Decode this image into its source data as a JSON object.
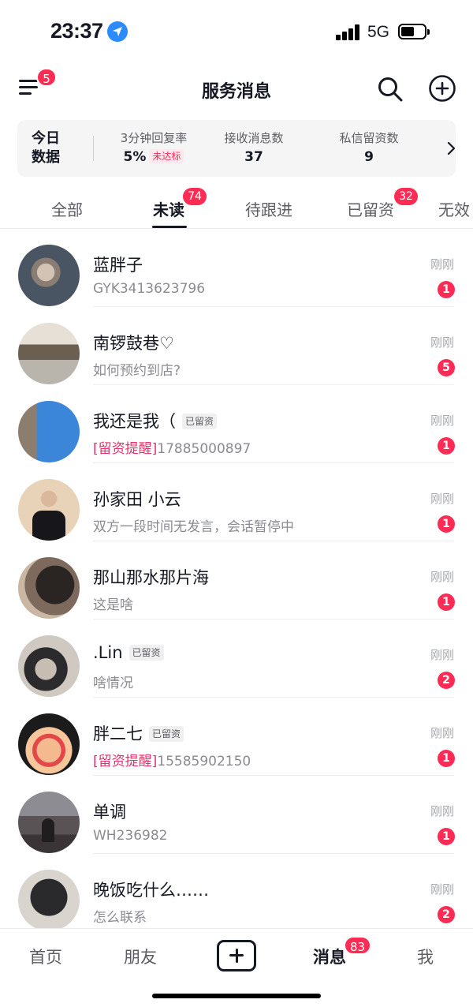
{
  "status_bar": {
    "time": "23:37",
    "network": "5G",
    "icons": [
      "location-icon",
      "signal-icon",
      "battery-icon"
    ]
  },
  "header": {
    "title": "服务消息",
    "menu_badge": "5",
    "icons": [
      "menu-icon",
      "search-icon",
      "add-circle-icon"
    ]
  },
  "stats": {
    "label_line1": "今日",
    "label_line2": "数据",
    "items": [
      {
        "label": "3分钟回复率",
        "value": "5%",
        "tag": "未达标"
      },
      {
        "label": "接收消息数",
        "value": "37"
      },
      {
        "label": "私信留资数",
        "value": "9"
      }
    ]
  },
  "tabs": [
    {
      "label": "全部"
    },
    {
      "label": "未读",
      "badge": "74",
      "active": true
    },
    {
      "label": "待跟进"
    },
    {
      "label": "已留资",
      "badge": "32"
    },
    {
      "label": "无效"
    }
  ],
  "messages": [
    {
      "name": "蓝胖子",
      "preview": "GYK3413623796",
      "time": "刚刚",
      "unread": "1"
    },
    {
      "name": "南锣鼓巷♡",
      "preview": "如何预约到店?",
      "time": "刚刚",
      "unread": "5"
    },
    {
      "name": "我还是我（",
      "tag": "已留资",
      "remind": "[留资提醒]",
      "preview": "17885000897",
      "time": "刚刚",
      "unread": "1"
    },
    {
      "name": "孙家田 小云",
      "preview": "双方一段时间无发言，会话暂停中",
      "time": "刚刚",
      "unread": "1"
    },
    {
      "name": "那山那水那片海",
      "preview": "这是啥",
      "time": "刚刚",
      "unread": "1"
    },
    {
      "name": ".Lin",
      "tag": "已留资",
      "preview": "啥情况",
      "time": "刚刚",
      "unread": "2"
    },
    {
      "name": "胖二七",
      "tag": "已留资",
      "remind": "[留资提醒]",
      "preview": "15585902150",
      "time": "刚刚",
      "unread": "1"
    },
    {
      "name": "单调",
      "preview": "WH236982",
      "time": "刚刚",
      "unread": "1"
    },
    {
      "name": "晚饭吃什么……",
      "preview": "怎么联系",
      "time": "刚刚",
      "unread": "2"
    }
  ],
  "bottom_nav": {
    "home": "首页",
    "friends": "朋友",
    "messages": "消息",
    "messages_badge": "83",
    "me": "我",
    "active": "messages"
  },
  "colors": {
    "accent": "#fe2c55",
    "remind": "#e8316b",
    "text": "#161823",
    "muted": "#8a8b91"
  }
}
